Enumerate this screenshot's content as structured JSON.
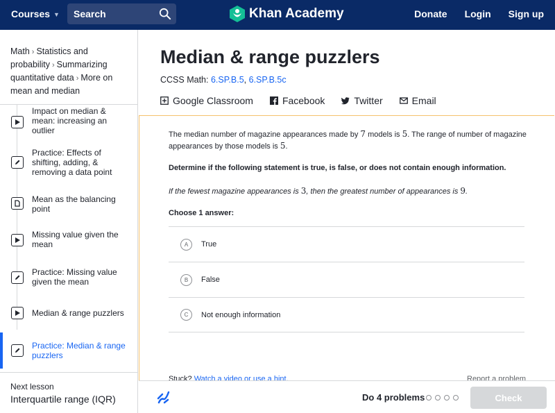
{
  "topbar": {
    "courses_label": "Courses",
    "search_placeholder": "Search",
    "logo_text": "Khan Academy",
    "donate": "Donate",
    "login": "Login",
    "signup": "Sign up",
    "bg_color": "#0a2a66"
  },
  "sidebar": {
    "breadcrumbs": [
      "Math",
      "Statistics and probability",
      "Summarizing quantitative data",
      "More on mean and median"
    ],
    "lessons": [
      {
        "type": "video",
        "label": "Impact on median & mean: increasing an outlier"
      },
      {
        "type": "practice",
        "label": "Practice: Effects of shifting, adding, & removing a data point"
      },
      {
        "type": "article",
        "label": "Mean as the balancing point"
      },
      {
        "type": "video",
        "label": "Missing value given the mean"
      },
      {
        "type": "practice",
        "label": "Practice: Missing value given the mean"
      },
      {
        "type": "video",
        "label": "Median & range puzzlers"
      },
      {
        "type": "practice",
        "label": "Practice: Median & range puzzlers",
        "active": true
      }
    ],
    "next_lesson_label": "Next lesson",
    "next_lesson_title": "Interquartile range (IQR)"
  },
  "main": {
    "title": "Median & range puzzlers",
    "ccss_prefix": "CCSS Math: ",
    "ccss_links": [
      "6.SP.B.5",
      "6.SP.B.5c"
    ],
    "share": {
      "google": "Google Classroom",
      "facebook": "Facebook",
      "twitter": "Twitter",
      "email": "Email"
    }
  },
  "exercise": {
    "q1_a": "The median number of magazine appearances made by ",
    "q1_n1": "7",
    "q1_b": " models is ",
    "q1_n2": "5",
    "q1_c": ". The range of number of magazine appearances by those models is ",
    "q1_n3": "5",
    "q1_d": ".",
    "instruction": "Determine if the following statement is true, is false, or does not contain enough information.",
    "stmt_a": "If the fewest magazine appearances is ",
    "stmt_n1": "3",
    "stmt_b": ", then the greatest number of appearances is ",
    "stmt_n2": "9",
    "stmt_c": ".",
    "choose": "Choose 1 answer:",
    "choices": [
      {
        "letter": "A",
        "label": "True"
      },
      {
        "letter": "B",
        "label": "False"
      },
      {
        "letter": "C",
        "label": "Not enough information"
      }
    ],
    "stuck_label": "Stuck?",
    "stuck_link": "Watch a video or use a hint.",
    "report": "Report a problem"
  },
  "footer": {
    "do_problems": "Do 4 problems",
    "check": "Check"
  },
  "colors": {
    "accent": "#1865f2",
    "exercise_border": "#f5c16c"
  }
}
